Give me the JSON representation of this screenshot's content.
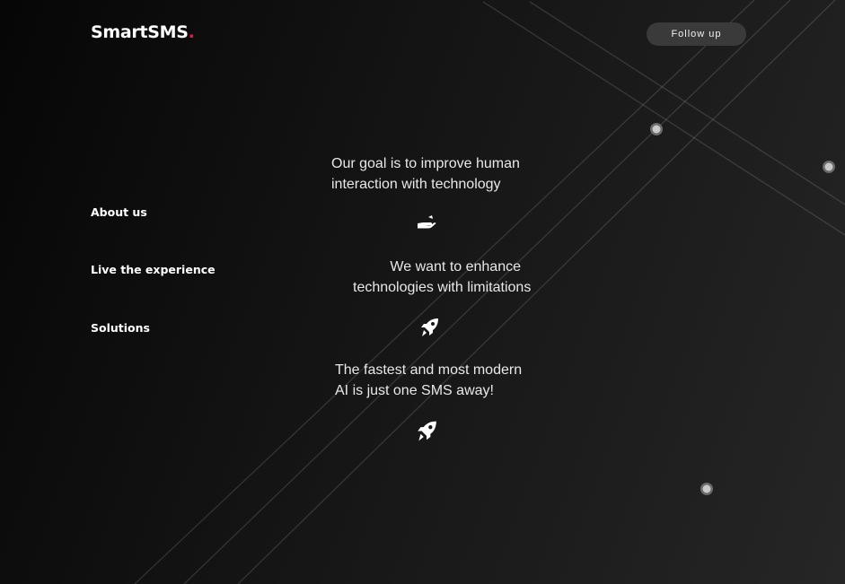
{
  "header": {
    "logo_text": "SmartSMS",
    "logo_dot": ".",
    "follow_label": "Follow up"
  },
  "nav": {
    "items": [
      "About us",
      "Live the experience",
      "Solutions"
    ]
  },
  "messages": [
    {
      "line1": "Our goal is to improve human",
      "line2": "interaction with technology",
      "icon": "hand-icon"
    },
    {
      "line1": "We want to enhance",
      "line2": "technologies with limitations",
      "icon": "rocket-icon"
    },
    {
      "line1": "The fastest and most modern",
      "line2": "AI is just one SMS away!",
      "icon": "rocket-icon"
    }
  ],
  "colors": {
    "accent": "#e8174a",
    "button_bg": "#3a3a3a",
    "background_dark": "#060606",
    "background_light": "#262626"
  }
}
